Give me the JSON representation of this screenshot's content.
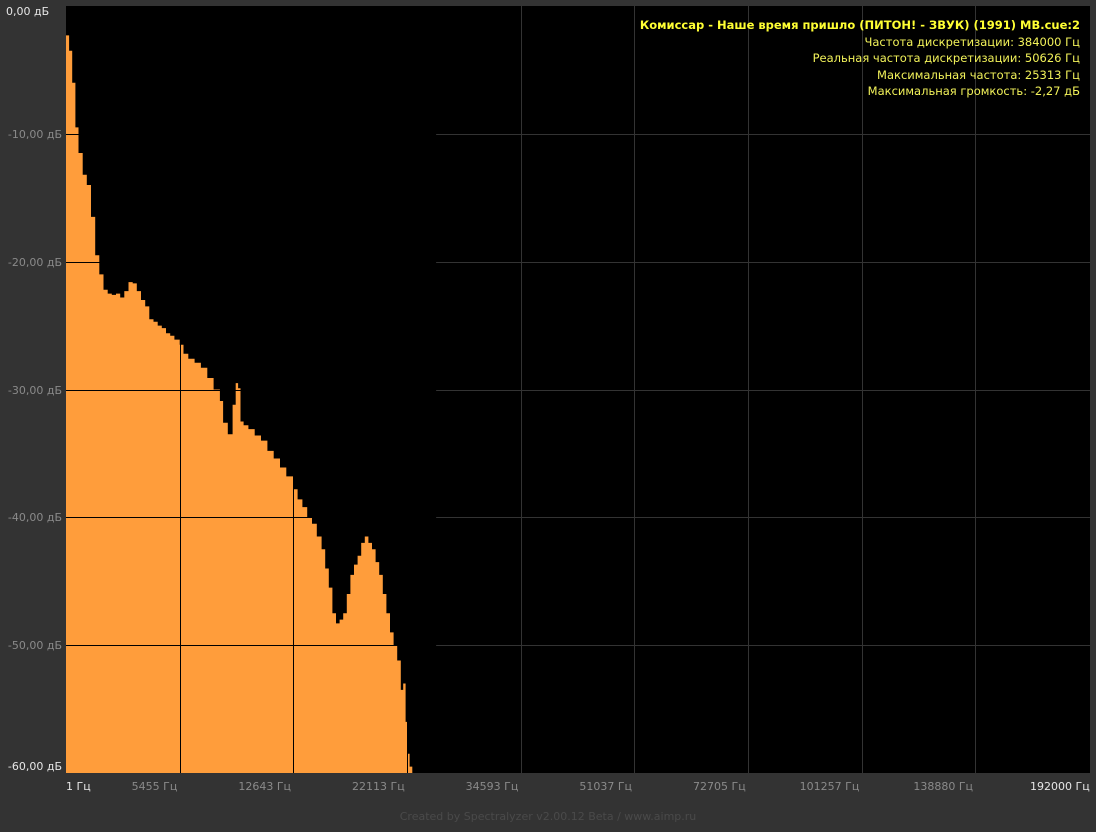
{
  "window": {
    "footer": "Created by Spectralyzer v2.00.12 Beta / www.aimp.ru"
  },
  "info": {
    "title": "Комиссар - Наше время пришло (ПИТОН! - ЗВУК) (1991) MB.cue:2",
    "lines": [
      "Частота дискретизации: 384000 Гц",
      "Реальная частота дискретизации: 50626 Гц",
      "Максимальная частота: 25313 Гц",
      "Максимальная громкость: -2,27 дБ"
    ]
  },
  "colors": {
    "background": "#333333",
    "plot_background": "#000000",
    "bar": "#ff9d3b",
    "grid": "#333333",
    "text_title": "#ffff33",
    "text_info": "#f2f25a"
  },
  "chart_data": {
    "type": "area",
    "ylim": [
      -60,
      0
    ],
    "y_ticks": [
      "0,00 дБ",
      "-10,00 дБ",
      "-20,00 дБ",
      "-30,00 дБ",
      "-40,00 дБ",
      "-50,00 дБ",
      "-60,00 дБ"
    ],
    "x_ticks": [
      "1 Гц",
      "5455 Гц",
      "12643 Гц",
      "22113 Гц",
      "34593 Гц",
      "51037 Гц",
      "72705 Гц",
      "101257 Гц",
      "138880 Гц",
      "192000 Гц"
    ],
    "grid": true,
    "x_scale": "nonlinear",
    "series": [
      {
        "points": [
          [
            1,
            -2.3
          ],
          [
            150,
            -3.5
          ],
          [
            300,
            -6
          ],
          [
            450,
            -9.5
          ],
          [
            600,
            -11.5
          ],
          [
            800,
            -13.2
          ],
          [
            1000,
            -14
          ],
          [
            1200,
            -16.5
          ],
          [
            1400,
            -19.5
          ],
          [
            1600,
            -21
          ],
          [
            1800,
            -22.2
          ],
          [
            2000,
            -22.5
          ],
          [
            2200,
            -22.6
          ],
          [
            2400,
            -22.5
          ],
          [
            2600,
            -22.8
          ],
          [
            2800,
            -22.3
          ],
          [
            3000,
            -21.6
          ],
          [
            3200,
            -21.7
          ],
          [
            3400,
            -22.3
          ],
          [
            3600,
            -23
          ],
          [
            3800,
            -23.5
          ],
          [
            4000,
            -24.5
          ],
          [
            4200,
            -24.7
          ],
          [
            4400,
            -25
          ],
          [
            4600,
            -25.2
          ],
          [
            4800,
            -25.6
          ],
          [
            5000,
            -25.8
          ],
          [
            5200,
            -26.1
          ],
          [
            5455,
            -26.5
          ],
          [
            5700,
            -27.2
          ],
          [
            6000,
            -27.6
          ],
          [
            6400,
            -27.9
          ],
          [
            6800,
            -28.3
          ],
          [
            7200,
            -29.1
          ],
          [
            7600,
            -30
          ],
          [
            8000,
            -30.9
          ],
          [
            8200,
            -32.6
          ],
          [
            8500,
            -33.5
          ],
          [
            8800,
            -31.2
          ],
          [
            9000,
            -29.5
          ],
          [
            9150,
            -29.9
          ],
          [
            9300,
            -32.5
          ],
          [
            9500,
            -32.8
          ],
          [
            9800,
            -33.1
          ],
          [
            10200,
            -33.6
          ],
          [
            10600,
            -34
          ],
          [
            11000,
            -34.8
          ],
          [
            11400,
            -35.4
          ],
          [
            11800,
            -36.1
          ],
          [
            12200,
            -36.8
          ],
          [
            12643,
            -37.8
          ],
          [
            13000,
            -38.6
          ],
          [
            13400,
            -39.2
          ],
          [
            13800,
            -40
          ],
          [
            14200,
            -40.5
          ],
          [
            14600,
            -41.5
          ],
          [
            15000,
            -42.5
          ],
          [
            15300,
            -44
          ],
          [
            15600,
            -45.5
          ],
          [
            15900,
            -47.5
          ],
          [
            16200,
            -48.3
          ],
          [
            16500,
            -48
          ],
          [
            16800,
            -47.5
          ],
          [
            17100,
            -46
          ],
          [
            17400,
            -44.5
          ],
          [
            17700,
            -43.7
          ],
          [
            18000,
            -43
          ],
          [
            18300,
            -42
          ],
          [
            18600,
            -41.5
          ],
          [
            18900,
            -42
          ],
          [
            19200,
            -42.5
          ],
          [
            19500,
            -43.5
          ],
          [
            19800,
            -44.5
          ],
          [
            20100,
            -46
          ],
          [
            20400,
            -47.5
          ],
          [
            20700,
            -49
          ],
          [
            21000,
            -50
          ],
          [
            21300,
            -51.2
          ],
          [
            21600,
            -53.5
          ],
          [
            21800,
            -53
          ],
          [
            22000,
            -56
          ],
          [
            22113,
            -58.5
          ],
          [
            22400,
            -59.5
          ],
          [
            22700,
            -60
          ],
          [
            23000,
            -60.3
          ],
          [
            23400,
            -60.5
          ],
          [
            23800,
            -61
          ],
          [
            24200,
            -60.2
          ],
          [
            24600,
            -60.7
          ],
          [
            25000,
            -61
          ],
          [
            25313,
            -61.5
          ]
        ]
      }
    ]
  }
}
